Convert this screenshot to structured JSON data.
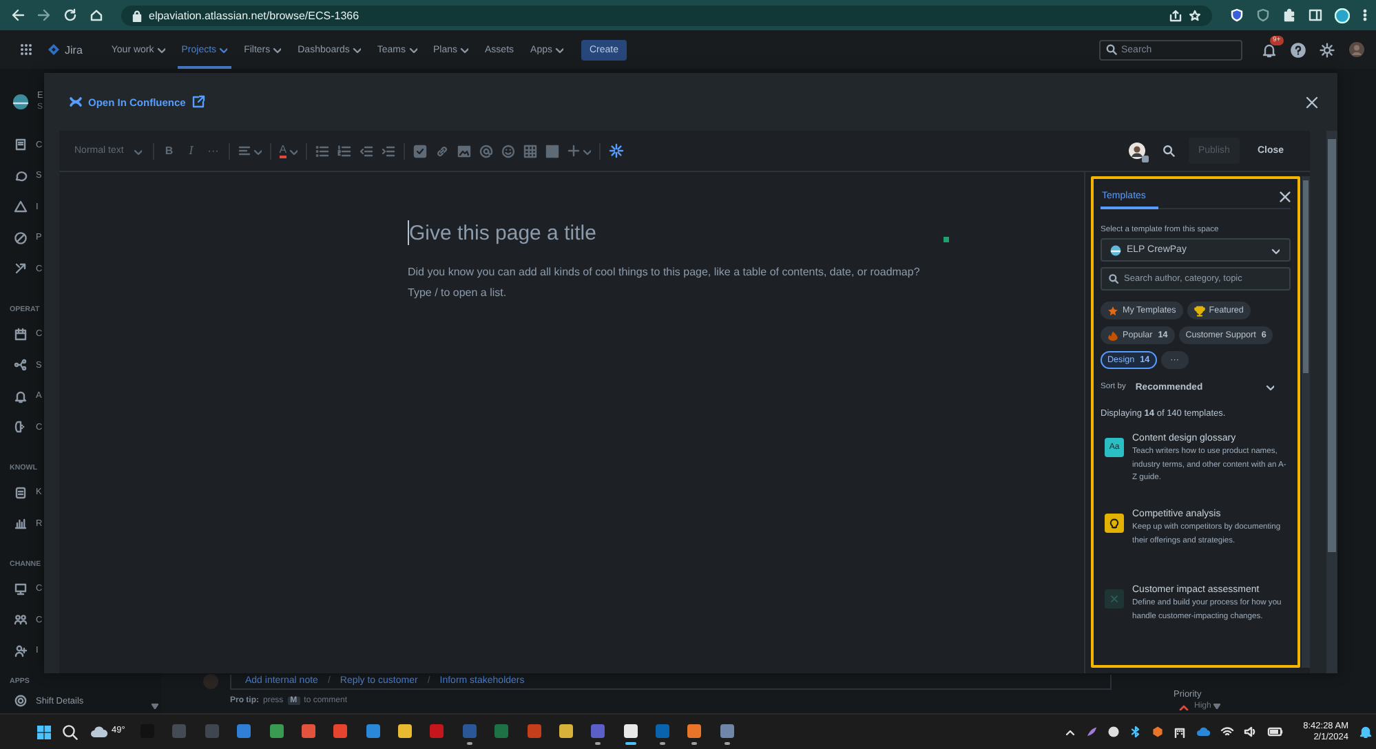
{
  "browser": {
    "url": "elpaviation.atlassian.net/browse/ECS-1366"
  },
  "nav": {
    "product": "Jira",
    "items": [
      {
        "label": "Your work",
        "dropdown": true,
        "selected": false
      },
      {
        "label": "Projects",
        "dropdown": true,
        "selected": true
      },
      {
        "label": "Filters",
        "dropdown": true,
        "selected": false
      },
      {
        "label": "Dashboards",
        "dropdown": true,
        "selected": false
      },
      {
        "label": "Teams",
        "dropdown": true,
        "selected": false
      },
      {
        "label": "Plans",
        "dropdown": true,
        "selected": false
      },
      {
        "label": "Assets",
        "dropdown": false,
        "selected": false
      },
      {
        "label": "Apps",
        "dropdown": true,
        "selected": false
      }
    ],
    "create": "Create",
    "search_placeholder": "Search",
    "notification_count": "9+"
  },
  "sidebar": {
    "project": {
      "name": "E",
      "subtitle": "S"
    },
    "sections": [
      {
        "items": [
          "C",
          "S",
          "I",
          "P",
          "C"
        ]
      },
      {
        "heading": "OPERAT",
        "items": [
          "C",
          "S",
          "A",
          "C"
        ]
      },
      {
        "heading": "KNOWL",
        "items": [
          "K",
          "R"
        ]
      },
      {
        "heading": "CHANNE",
        "items": [
          "C",
          "C",
          "I"
        ]
      },
      {
        "heading": "APPS",
        "items": [
          "Shift Details"
        ]
      }
    ]
  },
  "issue": {
    "comment_actions": [
      {
        "label": "Add internal note",
        "kind": "link"
      },
      {
        "label": "/",
        "kind": "separator"
      },
      {
        "label": "Reply to customer",
        "kind": "link"
      },
      {
        "label": "/",
        "kind": "separator"
      },
      {
        "label": "Inform stakeholders",
        "kind": "link"
      }
    ],
    "pro_tip": {
      "lead": "Pro tip:",
      "before": "press",
      "key": "M",
      "after": "to comment"
    },
    "details": [
      {
        "label": "Priority",
        "value": "High"
      }
    ]
  },
  "modal": {
    "open_in": "Open In Confluence",
    "editor": {
      "toolbar": {
        "style": "Normal text",
        "bold": "B",
        "italic": "I",
        "more": "···",
        "text_color": "A",
        "publish": {
          "label": "Publish",
          "disabled": true
        },
        "close": "Close"
      },
      "title_placeholder": "Give this page a title",
      "body": [
        "Did you know you can add all kinds of cool things to this page, like a table of contents, date, or roadmap?",
        "Type / to open a list."
      ]
    },
    "templates": {
      "tabs": [
        {
          "label": "Templates",
          "selected": true
        }
      ],
      "space_label": "Select a template from this space",
      "space": "ELP CrewPay",
      "search_placeholder": "Search author, category, topic",
      "filters": [
        {
          "label": "My Templates",
          "kind": "star",
          "selected": false
        },
        {
          "label": "Featured",
          "kind": "trophy",
          "selected": false
        },
        {
          "label": "Popular",
          "count": "14",
          "kind": "fire",
          "selected": false
        },
        {
          "label": "Customer Support",
          "count": "6",
          "kind": "plain",
          "selected": false
        },
        {
          "label": "Design",
          "count": "14",
          "kind": "plain",
          "selected": true
        },
        {
          "label": "···",
          "kind": "more",
          "selected": false
        }
      ],
      "sort": {
        "label": "Sort by",
        "value": "Recommended"
      },
      "summary": "Displaying **14** of 140 templates.",
      "items": [
        {
          "title": "Content design glossary",
          "description": "Teach writers how to use product names, industry terms, and other content with an A-Z guide.",
          "color": "#2bbfc4",
          "icon_text": "Aa"
        },
        {
          "title": "Competitive analysis",
          "description": "Keep up with competitors by documenting their offerings and strategies.",
          "color": "#e2b203"
        },
        {
          "title": "Customer impact assessment",
          "description": "Define and build your process for how you handle customer-impacting changes.",
          "color": "#1f3434"
        }
      ]
    }
  },
  "taskbar": {
    "weather": "49°",
    "apps": [
      {
        "running": false,
        "selected": false
      },
      {
        "running": false,
        "selected": false
      },
      {
        "running": false,
        "selected": false
      },
      {
        "running": false,
        "selected": false
      },
      {
        "running": false,
        "selected": false
      },
      {
        "running": false,
        "selected": false
      },
      {
        "running": false,
        "selected": false
      },
      {
        "running": false,
        "selected": false
      },
      {
        "running": false,
        "selected": false
      },
      {
        "running": false,
        "selected": false
      },
      {
        "running": true,
        "selected": false
      },
      {
        "running": false,
        "selected": false
      },
      {
        "running": false,
        "selected": false
      },
      {
        "running": false,
        "selected": false
      },
      {
        "running": true,
        "selected": false
      },
      {
        "running": true,
        "selected": true
      },
      {
        "running": true,
        "selected": false
      },
      {
        "running": true,
        "selected": false
      },
      {
        "running": true,
        "selected": false
      }
    ],
    "time": "8:42:28 AM",
    "date": "2/1/2024"
  }
}
